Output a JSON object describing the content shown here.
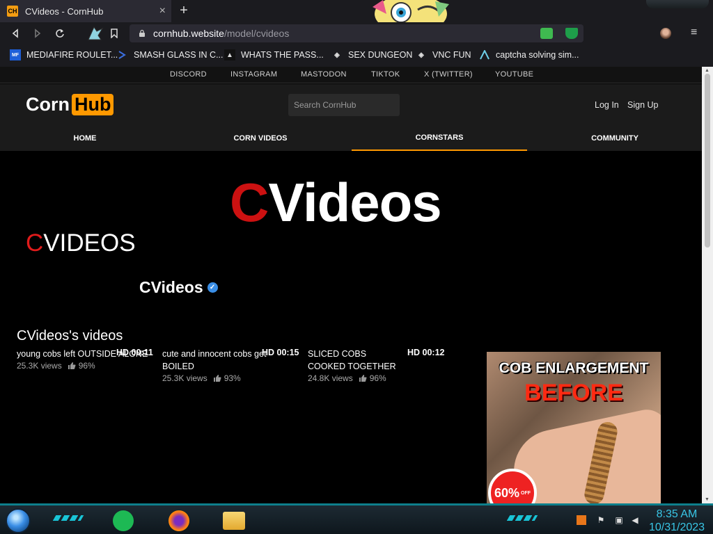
{
  "browser": {
    "tab": {
      "favicon_text": "CH",
      "title": "CVideos - CornHub",
      "close": "×"
    },
    "new_tab": "+",
    "url": {
      "host": "cornhub.website",
      "path": "/model/cvideos"
    },
    "bookmarks": [
      {
        "icon": "MF",
        "label": "MEDIAFIRE ROULET..."
      },
      {
        "icon": "",
        "label": "SMASH GLASS IN C..."
      },
      {
        "icon": "",
        "label": "WHATS THE PASS..."
      },
      {
        "icon": "",
        "label": "SEX DUNGEON"
      },
      {
        "icon": "",
        "label": "VNC FUN"
      },
      {
        "icon": "",
        "label": "captcha solving sim..."
      }
    ]
  },
  "site": {
    "social_links": [
      "DISCORD",
      "INSTAGRAM",
      "MASTODON",
      "TIKTOK",
      "X (TWITTER)",
      "YOUTUBE"
    ],
    "logo": {
      "part1": "Corn",
      "part2": "Hub"
    },
    "search_placeholder": "Search CornHub",
    "auth": {
      "login": "Log In",
      "signup": "Sign Up"
    },
    "main_nav": [
      {
        "label": "HOME",
        "active": false
      },
      {
        "label": "CORN VIDEOS",
        "active": false
      },
      {
        "label": "CORNSTARS",
        "active": true
      },
      {
        "label": "COMMUNITY",
        "active": false
      }
    ]
  },
  "profile": {
    "banner": {
      "first": "C",
      "rest": "Videos"
    },
    "page_logo": {
      "first": "C",
      "rest": "VIDEOS"
    },
    "channel_name": "CVideos",
    "videos_heading": "CVideos's videos",
    "videos": [
      {
        "title": "young cobs left OUTSIDE ALONE",
        "duration": "HD 00:11",
        "views": "25.3K views",
        "rating": "96%"
      },
      {
        "title": "cute and innocent cobs get BOILED",
        "duration": "HD 00:15",
        "views": "25.3K views",
        "rating": "93%"
      },
      {
        "title": "SLICED COBS COOKED TOGETHER",
        "duration": "HD 00:12",
        "views": "24.8K views",
        "rating": "96%"
      }
    ]
  },
  "ad": {
    "line1": "COB ENLARGEMENT",
    "line2": "BEFORE",
    "badge": "60%",
    "badge_sub": "OFF"
  },
  "taskbar": {
    "time": "8:35 AM",
    "date": "10/31/2023"
  },
  "colors": {
    "accent": "#ff9900",
    "brand_red": "#cc1111",
    "verified": "#3a8ee6"
  }
}
